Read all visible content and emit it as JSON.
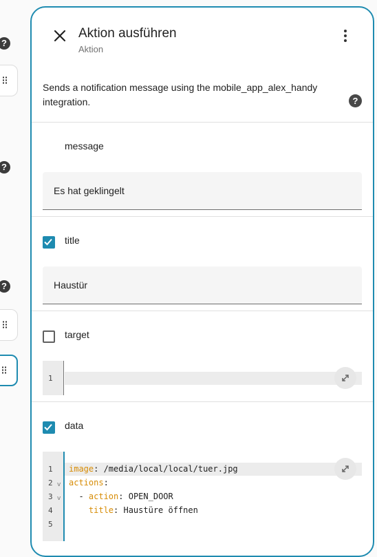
{
  "dialog": {
    "title": "Aktion ausführen",
    "subtitle": "Aktion",
    "description": "Sends a notification message using the mobile_app_alex_handy integration."
  },
  "fields": {
    "message": {
      "label": "message",
      "value": "Es hat geklingelt"
    },
    "title": {
      "label": "title",
      "value": "Haustür",
      "checked": true
    },
    "target": {
      "label": "target",
      "checked": false,
      "line_numbers": [
        "1"
      ]
    },
    "data": {
      "label": "data",
      "checked": true,
      "line_numbers": [
        "1",
        "2",
        "3",
        "4",
        "5"
      ],
      "code": {
        "line1_key": "image",
        "line1_value": ": /media/local/local/tuer.jpg",
        "line2_key": "actions",
        "line2_value": ":",
        "line3_prefix": "  - ",
        "line3_key": "action",
        "line3_value": ": OPEN_DOOR",
        "line4_prefix": "    ",
        "line4_key": "title",
        "line4_value": ": Haustüre öffnen"
      }
    }
  },
  "icons": {
    "close": "close-icon",
    "more": "more-vert-icon",
    "help": "help-circle-icon",
    "fullscreen": "fullscreen-icon",
    "drag": "drag-handle-icon",
    "fold": "chevron-down-icon"
  },
  "colors": {
    "accent": "#1e8bb0",
    "yaml_key": "#d78c06"
  }
}
